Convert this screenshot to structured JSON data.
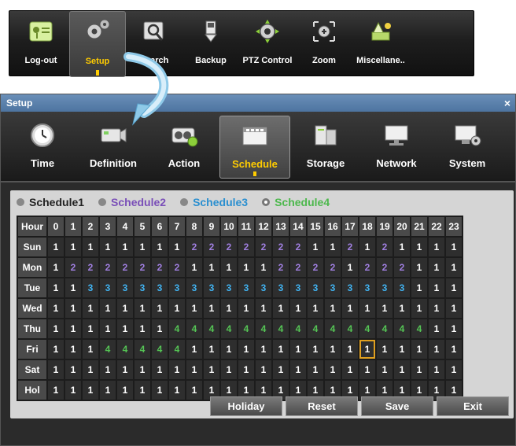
{
  "menu": {
    "items": [
      {
        "label": "Log-out",
        "icon": "key-icon"
      },
      {
        "label": "Setup",
        "icon": "gears-icon",
        "active": true
      },
      {
        "label": "Search",
        "icon": "magnifier-icon"
      },
      {
        "label": "Backup",
        "icon": "usb-icon"
      },
      {
        "label": "PTZ Control",
        "icon": "ptz-camera-icon"
      },
      {
        "label": "Zoom",
        "icon": "zoom-icon"
      },
      {
        "label": "Miscellane..",
        "icon": "misc-icon"
      }
    ]
  },
  "window": {
    "title": "Setup",
    "close_label": "×",
    "tabs": [
      {
        "label": "Time",
        "icon": "clock-icon"
      },
      {
        "label": "Definition",
        "icon": "camera-icon"
      },
      {
        "label": "Action",
        "icon": "action-icon"
      },
      {
        "label": "Schedule",
        "icon": "schedule-icon",
        "active": true
      },
      {
        "label": "Storage",
        "icon": "storage-icon"
      },
      {
        "label": "Network",
        "icon": "monitor-icon"
      },
      {
        "label": "System",
        "icon": "system-icon"
      }
    ]
  },
  "legend": {
    "items": [
      "Schedule1",
      "Schedule2",
      "Schedule3",
      "Schedule4"
    ],
    "selected": 3
  },
  "grid": {
    "corner": "Hour",
    "hours": [
      "0",
      "1",
      "2",
      "3",
      "4",
      "5",
      "6",
      "7",
      "8",
      "9",
      "10",
      "11",
      "12",
      "13",
      "14",
      "15",
      "16",
      "17",
      "18",
      "19",
      "20",
      "21",
      "22",
      "23"
    ],
    "days": [
      "Sun",
      "Mon",
      "Tue",
      "Wed",
      "Thu",
      "Fri",
      "Sat",
      "Hol"
    ],
    "rows": [
      [
        1,
        1,
        1,
        1,
        1,
        1,
        1,
        1,
        2,
        2,
        2,
        2,
        2,
        2,
        2,
        1,
        1,
        2,
        1,
        2,
        1,
        1,
        1,
        1
      ],
      [
        1,
        2,
        2,
        2,
        2,
        2,
        2,
        2,
        1,
        1,
        1,
        1,
        1,
        2,
        2,
        2,
        2,
        1,
        2,
        2,
        2,
        1,
        1,
        1
      ],
      [
        1,
        1,
        3,
        3,
        3,
        3,
        3,
        3,
        3,
        3,
        3,
        3,
        3,
        3,
        3,
        3,
        3,
        3,
        3,
        3,
        3,
        1,
        1,
        1
      ],
      [
        1,
        1,
        1,
        1,
        1,
        1,
        1,
        1,
        1,
        1,
        1,
        1,
        1,
        1,
        1,
        1,
        1,
        1,
        1,
        1,
        1,
        1,
        1,
        1
      ],
      [
        1,
        1,
        1,
        1,
        1,
        1,
        1,
        4,
        4,
        4,
        4,
        4,
        4,
        4,
        4,
        4,
        4,
        4,
        4,
        4,
        4,
        4,
        1,
        1
      ],
      [
        1,
        1,
        1,
        4,
        4,
        4,
        4,
        4,
        1,
        1,
        1,
        1,
        1,
        1,
        1,
        1,
        1,
        1,
        1,
        1,
        1,
        1,
        1,
        1
      ],
      [
        1,
        1,
        1,
        1,
        1,
        1,
        1,
        1,
        1,
        1,
        1,
        1,
        1,
        1,
        1,
        1,
        1,
        1,
        1,
        1,
        1,
        1,
        1,
        1
      ],
      [
        1,
        1,
        1,
        1,
        1,
        1,
        1,
        1,
        1,
        1,
        1,
        1,
        1,
        1,
        1,
        1,
        1,
        1,
        1,
        1,
        1,
        1,
        1,
        1
      ]
    ],
    "selected_cell": {
      "day": "Fri",
      "hour": "18"
    }
  },
  "buttons": {
    "holiday": "Holiday",
    "reset": "Reset",
    "save": "Save",
    "exit": "Exit"
  },
  "colors": {
    "schedule1": "#ffffff",
    "schedule2": "#a07fe0",
    "schedule3": "#41b2f0",
    "schedule4": "#55c555",
    "active_label": "#ffcc00",
    "title_bar": "#5a80ac"
  }
}
